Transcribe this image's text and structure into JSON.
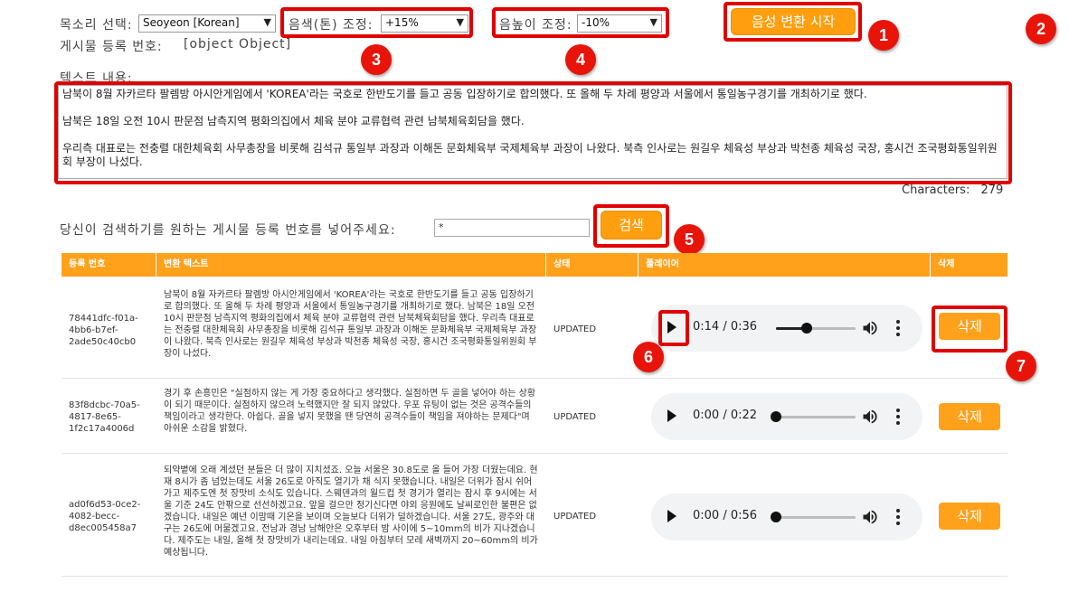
{
  "controls": {
    "voice_label": "목소리 선택:",
    "voice_value": "Seoyeon [Korean]",
    "tone_label": "음색(톤) 조정:",
    "tone_value": "+15%",
    "pitch_label": "음높이 조정:",
    "pitch_value": "-10%",
    "convert_button": "음성 변환 시작",
    "post_id_label": "게시물 등록 번호:",
    "post_id_value": "[object Object]",
    "text_label": "텍스트 내용:",
    "text_paragraphs": [
      "남북이 8월 자카르타 팔렘방 아시안게임에서 'KOREA'라는 국호로 한반도기를 들고 공동 입장하기로 합의했다. 또 올해 두 차례 평양과 서울에서 통일농구경기를 개최하기로 했다.",
      "남북은 18일 오전 10시 판문점 남측지역 평화의집에서 체육 분야 교류협력 관련 남북체육회담을 했다.",
      "우리측 대표로는 전충렬 대한체육회 사무총장을 비롯해 김석규 통일부 과장과 이해돈 문화체육부 국제체육부 과장이 나왔다. 북측 인사로는 원길우 체육성 부상과 박천종 체육성 국장, 홍시건 조국평화통일위원회 부장이 나섰다."
    ],
    "characters_label": "Characters:",
    "characters_value": "279"
  },
  "search": {
    "label": "당신이 검색하기를 원하는 게시물 등록 번호를 넣어주세요:",
    "value": "*",
    "button": "검색"
  },
  "table": {
    "headers": [
      "등록 번호",
      "변환 텍스트",
      "상태",
      "플레이어",
      "삭제"
    ],
    "rows": [
      {
        "id": "78441dfc-f01a-4bb6-b7ef-2ade50c40cb0",
        "text": "남북이 8월 자카르타 팔렘방 아시안게임에서 'KOREA'라는 국호로 한반도기를 들고 공동 입장하기로 합의했다. 또 올해 두 차례 평양과 서울에서 통일농구경기를 개최하기로 했다. 남북은 18일 오전 10시 판문점 남측지역 평화의집에서 체육 분야 교류협력 관련 남북체육회담을 했다. 우리측 대표로는 전충렬 대한체육회 사무총장을 비롯해 김석규 통일부 과장과 이해돈 문화체육부 국제체육부 과장이 나왔다. 북측 인사로는 원길우 체육성 부상과 박천종 체육성 국장, 홍시건 조국평화통일위원회 부장이 나섰다.",
        "status": "UPDATED",
        "time": "0:14 / 0:36",
        "progress": 0.39,
        "delete": "삭제"
      },
      {
        "id": "83f8dcbc-70a5-4817-8e65-1f2c17a4006d",
        "text": "경기 후 손흥민은 \"실점하지 않는 게 가장 중요하다고 생각했다. 실점하면 두 골을 넣어야 하는 상황이 되기 때문이다. 실점하지 않으려 노력했지만 잘 되지 않았다. 우포 유팅이 없는 것은 공격수들의 책임이라고 생각한다. 아쉽다. 골을 넣지 못했을 땐 당연히 공격수들이 책임을 져야하는 문제다\"며 아쉬운 소감을 밝혔다.",
        "status": "UPDATED",
        "time": "0:00 / 0:22",
        "progress": 0.0,
        "delete": "삭제"
      },
      {
        "id": "ad0f6d53-0ce2-4082-becc-d8ec005458a7",
        "text": "되약볕에 오래 계셨던 분들은 더 많이 지치셨죠. 오늘 서울은 30.8도로 올 들어 가장 더웠는데요. 현재 8시가 좀 넘었는데도 서울 26도로 아직도 열기가 채 식지 못했습니다. 내일은 더위가 잠시 쉬어가고 제주도엔 첫 장맛비 소식도 있습니다. 스웨덴과의 월드컵 첫 경기가 열리는 잠시 후 9시에는 서울 기준 24도 안팎으로 선선하겠고요. 앞을 걸으만 정기신다면 야외 응원에도 날씨로인한 불편은 없겠습니다. 내일은 예년 이맘때 기온을 보이며 오늘보다 더위가 덜하겠습니다. 서울 27도, 광주와 대구는 26도에 머물겠고요. 전남과 경남 남해안은 오후부터 밤 사이에 5~10mm의 비가 지나겠습니다. 제주도는 내일, 올해 첫 장맛비가 내리는데요. 내일 아침부터 모레 새벽까지 20~60mm의 비가 예상됩니다.",
        "status": "UPDATED",
        "time": "0:00 / 0:56",
        "progress": 0.0,
        "delete": "삭제"
      }
    ]
  },
  "annotations": [
    "1",
    "2",
    "3",
    "4",
    "5",
    "6",
    "7"
  ],
  "colors": {
    "accent": "#ffa11b",
    "highlight": "#e00000",
    "badge": "#e8140a"
  },
  "icons": [
    "dropdown-arrow-icon",
    "play-icon",
    "volume-icon",
    "more-options-icon"
  ]
}
